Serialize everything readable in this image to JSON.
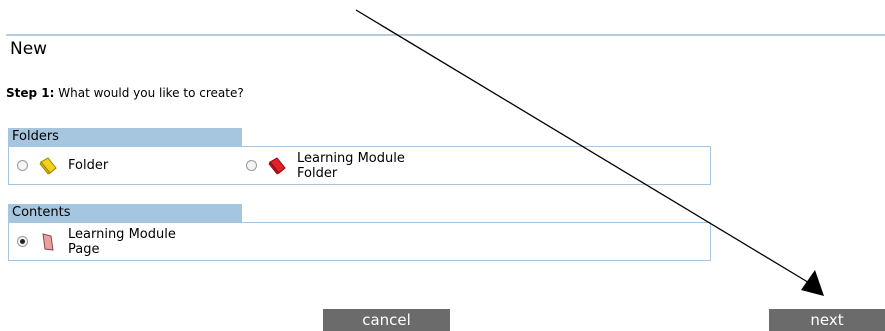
{
  "page": {
    "title": "New",
    "step_prefix": "Step 1:",
    "step_question": " What would you like to create?"
  },
  "sections": {
    "folders": {
      "header": "Folders",
      "options": [
        {
          "label": "Folder",
          "icon": "yellow-folder-icon",
          "color": "#f2d21b",
          "selected": false
        },
        {
          "label": "Learning Module\nFolder",
          "icon": "red-folder-icon",
          "color": "#e0202a",
          "selected": false
        }
      ]
    },
    "contents": {
      "header": "Contents",
      "options": [
        {
          "label": "Learning Module\nPage",
          "icon": "page-icon",
          "color": "#e8a0a0",
          "selected": true
        }
      ]
    }
  },
  "buttons": {
    "cancel": "cancel",
    "next": "next"
  },
  "colors": {
    "section_header_bg": "#a6c5de",
    "button_bg": "#6b6b6b",
    "title_rule": "#b5cde0"
  }
}
